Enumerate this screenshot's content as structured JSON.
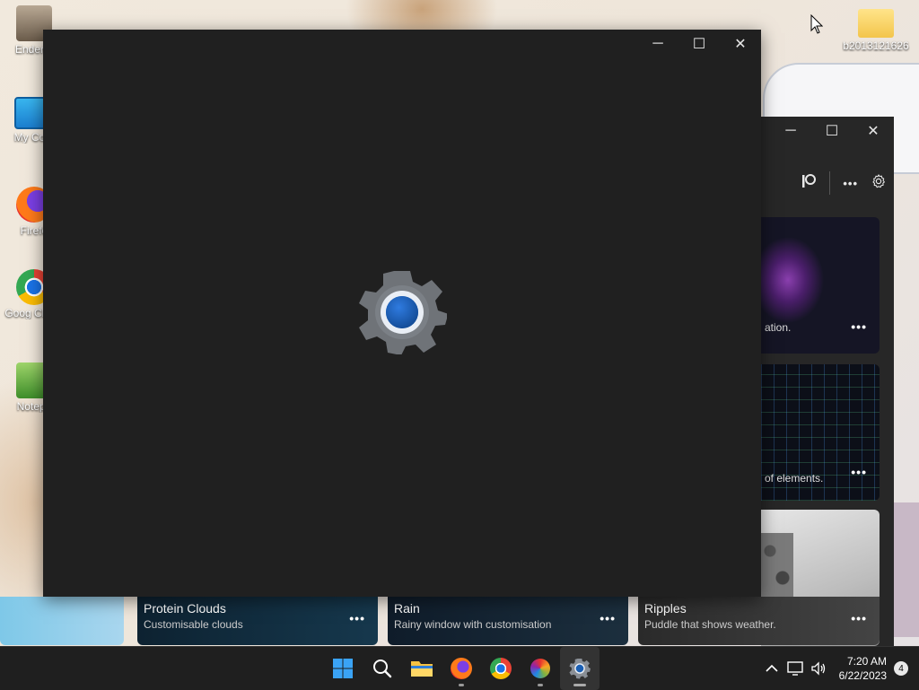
{
  "desktop": {
    "icons": [
      {
        "label": "Enderm"
      },
      {
        "label": "My Com"
      },
      {
        "label": "Firefo"
      },
      {
        "label": "Goog Chron"
      },
      {
        "label": "Notepa"
      },
      {
        "label": "b2013121626"
      }
    ]
  },
  "settings_window": {
    "splash_icon": "settings-gear-icon",
    "controls": {
      "minimize": "─",
      "maximize": "☐",
      "close": "✕"
    }
  },
  "wallpaper_window": {
    "controls": {
      "minimize": "─",
      "maximize": "☐",
      "close": "✕"
    },
    "toolbar": {
      "patreon_icon": "patreon-icon",
      "more": "•••",
      "settings_icon": "gear-icon"
    },
    "cards": [
      {
        "desc": "ation.",
        "more": "•••"
      },
      {
        "desc": "of elements.",
        "more": "•••"
      },
      {
        "desc": "",
        "more": "•••"
      }
    ],
    "bottom_cards": [
      {
        "title": "Protein Clouds",
        "subtitle": "Customisable clouds",
        "more": "•••"
      },
      {
        "title": "Rain",
        "subtitle": "Rainy window with customisation",
        "more": "•••"
      },
      {
        "title": "Ripples",
        "subtitle": "Puddle that shows weather.",
        "more": "•••"
      }
    ]
  },
  "taskbar": {
    "apps": [
      "start-icon",
      "search-icon",
      "file-explorer-icon",
      "firefox-icon",
      "chrome-icon",
      "color-wheel-icon",
      "settings-icon"
    ],
    "tray": {
      "chevron": "^"
    },
    "time": "7:20 AM",
    "date": "6/22/2023",
    "notification_count": "4"
  }
}
